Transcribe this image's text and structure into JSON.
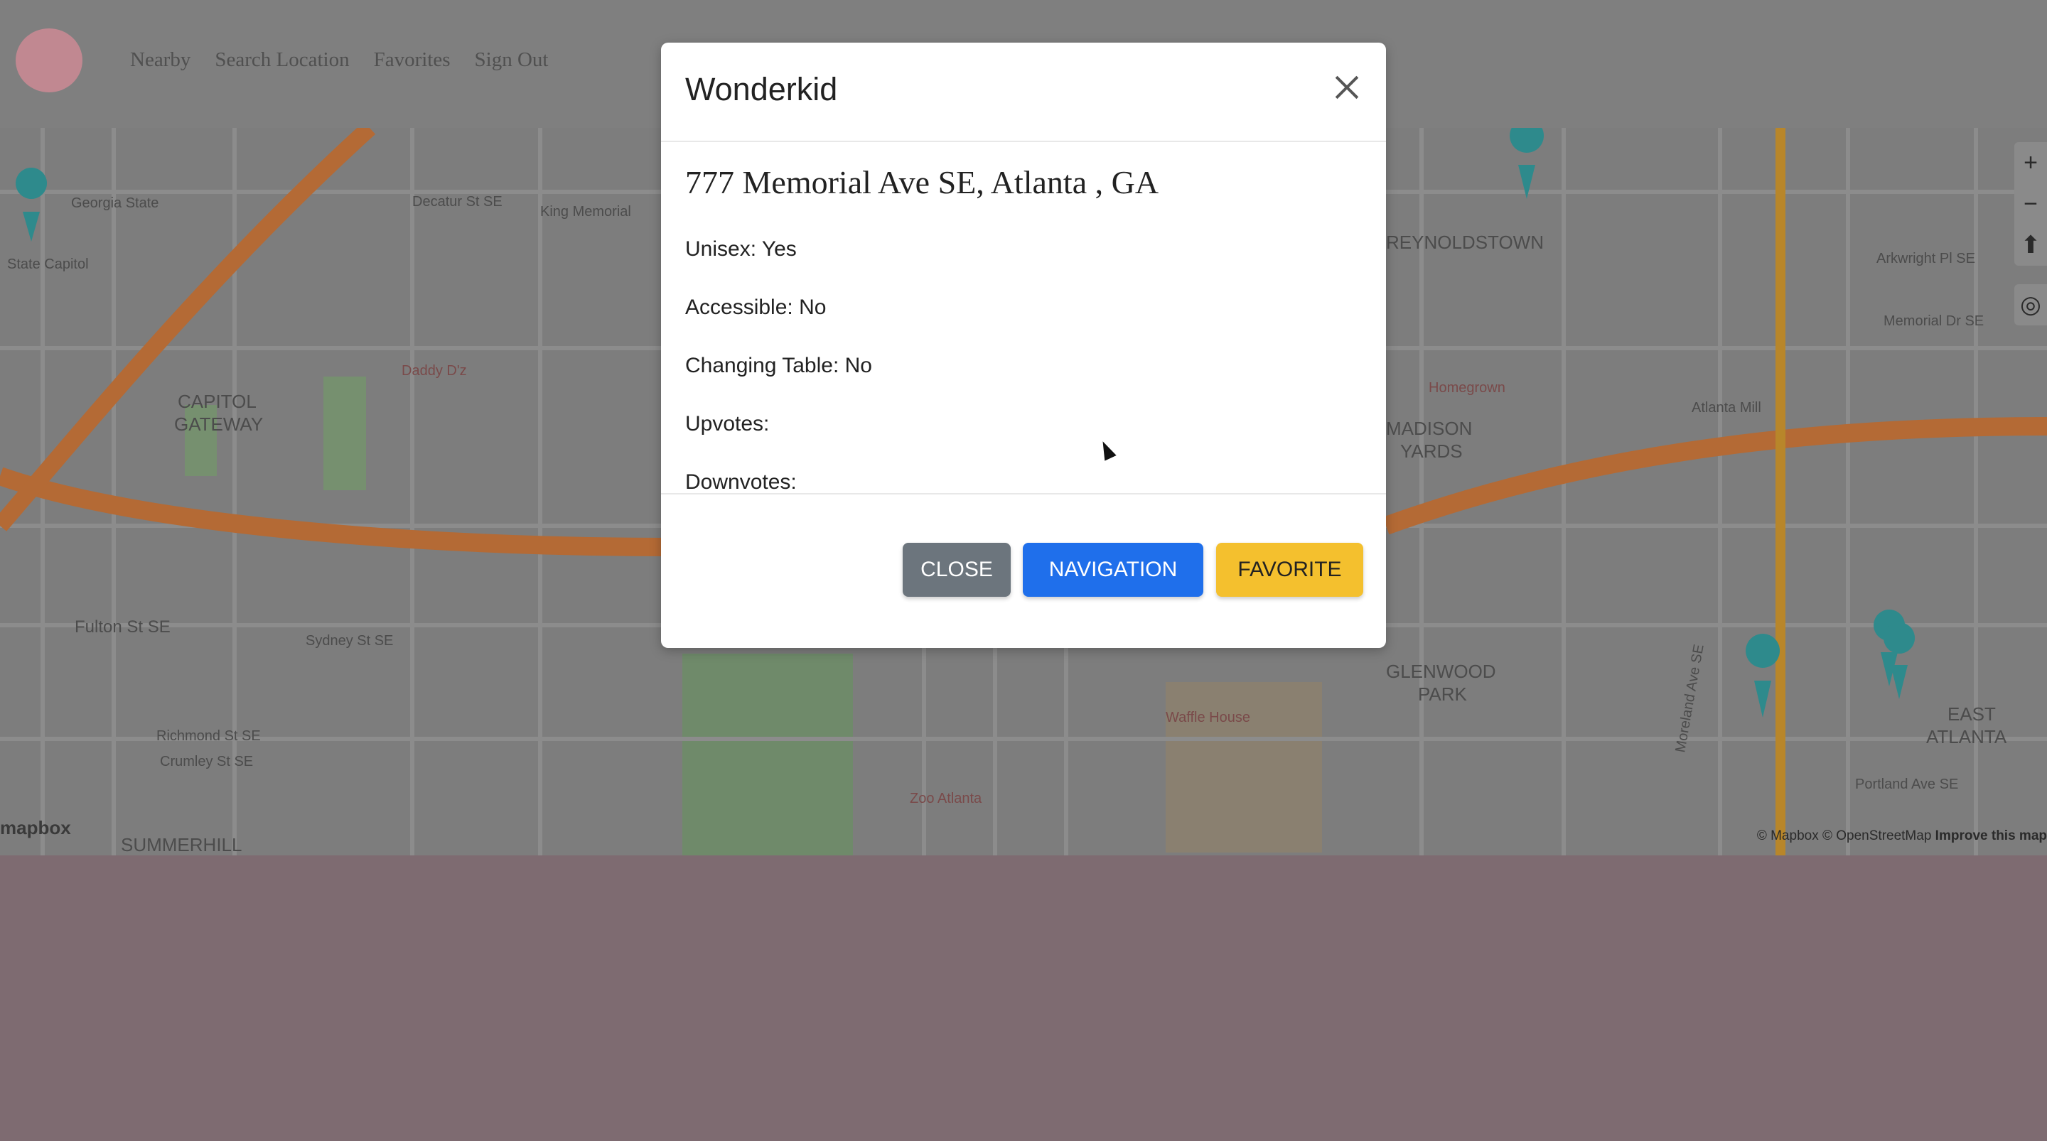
{
  "navbar": {
    "links": [
      "Nearby",
      "Search Location",
      "Favorites",
      "Sign Out"
    ]
  },
  "map": {
    "labels": [
      "Georgia State",
      "State Capitol",
      "Decatur St SE",
      "King Memorial",
      "CAPITOL",
      "GATEWAY",
      "Daddy D'z",
      "Fulton St SE",
      "Sydney St SE",
      "Richmond St SE",
      "Crumley St SE",
      "SUMMERHILL",
      "Arkwright Pl SE",
      "Memorial Dr SE",
      "REYNOLDSTOWN",
      "MADISON",
      "YARDS",
      "GLENWOOD",
      "PARK",
      "EAST",
      "ATLANTA",
      "Waffle House",
      "Zoo Atlanta",
      "Moreland Ave SE",
      "Portland Ave SE",
      "Atlanta Mill",
      "Homegrown"
    ],
    "zoom_in": "+",
    "zoom_out": "−",
    "compass": "⬆",
    "locate": "◎",
    "attribution_prefix": "© Mapbox © OpenStreetMap",
    "attribution_link": "Improve this map",
    "logo_text": "mapbox",
    "accent_road": "#c96a2c",
    "highway_color": "#b8862a",
    "pin_color": "#2e8a8c"
  },
  "modal": {
    "title": "Wonderkid",
    "close_icon": "close-icon",
    "address": "777 Memorial Ave SE, Atlanta , GA",
    "unisex": "Unisex: Yes",
    "accessible": "Accessible: No",
    "changing_table": "Changing Table: No",
    "upvotes": "Upvotes:",
    "downvotes": "Downvotes:",
    "buttons": {
      "close": "CLOSE",
      "navigation": "NAVIGATION",
      "favorite": "FAVORITE"
    }
  },
  "colors": {
    "close_btn": "#6c757d",
    "nav_btn": "#1f6feb",
    "fav_btn": "#f4c02e",
    "overlay_panel": "#7e6b71"
  }
}
